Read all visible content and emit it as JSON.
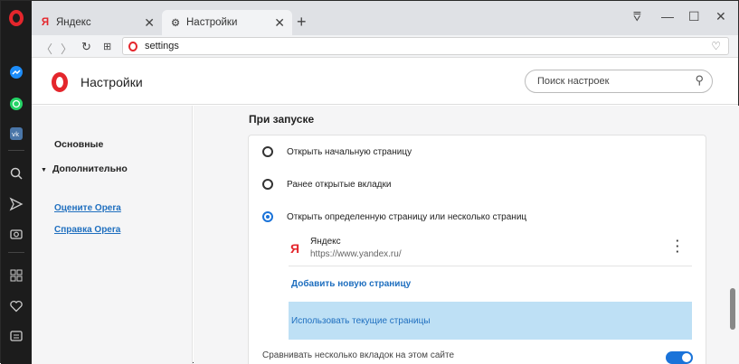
{
  "tabs": [
    {
      "label": "Яндекс",
      "icon": "yandex-icon"
    },
    {
      "label": "Настройки",
      "icon": "gear-icon"
    }
  ],
  "address": {
    "url": "settings"
  },
  "header": {
    "title": "Настройки",
    "search_placeholder": "Поиск настроек"
  },
  "nav": {
    "items": [
      "Основные",
      "Дополнительно"
    ],
    "links": [
      "Оцените Opera",
      "Справка Opera"
    ]
  },
  "section": {
    "title": "При запуске",
    "options": [
      {
        "label": "Открыть начальную страницу",
        "selected": false
      },
      {
        "label": "Ранее открытые вкладки",
        "selected": false
      },
      {
        "label": "Открыть определенную страницу или несколько страниц",
        "selected": true
      }
    ],
    "site": {
      "name": "Яндекс",
      "url": "https://www.yandex.ru/"
    },
    "add_page": "Добавить новую страницу",
    "use_current": "Использовать текущие страницы",
    "next_setting": "Сравнивать несколько вкладок на этом сайте",
    "next_setting_on": true
  },
  "colors": {
    "accent": "#1a73d9",
    "brand": "#e4262c",
    "highlight": "#bee0f5"
  }
}
